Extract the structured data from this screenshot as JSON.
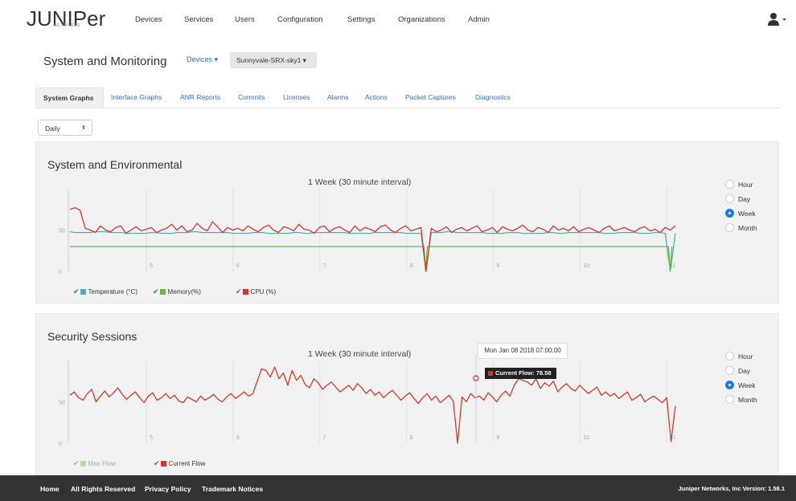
{
  "app": {
    "logo": "JUNIPer",
    "logo_sub": "NETWORKS"
  },
  "nav": {
    "items": [
      "Devices",
      "Services",
      "Users",
      "Configuration",
      "Settings",
      "Organizations",
      "Admin"
    ]
  },
  "header": {
    "title": "System and Monitoring",
    "devices_link": "Devices ▾",
    "device_select": "Sunnyvale-SRX-sky1 ▾"
  },
  "tabs": [
    "System Graphs",
    "Interface Graphs",
    "ANR Reports",
    "Commits",
    "Licenses",
    "Alarms",
    "Actions",
    "Packet Captures",
    "Diagnostics"
  ],
  "active_tab": "System Graphs",
  "period_select": {
    "value": "Daily",
    "arrow": "⬍"
  },
  "radio_options": [
    "Hour",
    "Day",
    "Week",
    "Month"
  ],
  "radio_selected": "Week",
  "colors": {
    "temperature": "#5aabaf",
    "memory": "#68b83c",
    "cpu": "#cc3a2e",
    "max_flow": "#b9dab0",
    "current_flow": "#cc3a2e",
    "accent": "#1e7be0"
  },
  "panels": {
    "system": {
      "title": "System and Environmental",
      "subtitle": "1 Week (30 minute interval)",
      "legend": [
        "Temperature (°C)",
        "Memory(%)",
        "CPU (%)"
      ]
    },
    "security": {
      "title": "Security Sessions",
      "subtitle": "1 Week (30 minute interval)",
      "legend": [
        "Max Flow",
        "Current Flow"
      ],
      "tooltip_date": "Mon Jan 08 2018 07:00:00",
      "tooltip_value": "Current Flow: 78.58"
    }
  },
  "chart_data": [
    {
      "type": "line",
      "title": "System and Environmental",
      "subtitle": "1 Week (30 minute interval)",
      "x_ticks": [
        "5",
        "6",
        "7",
        "8",
        "9",
        "10",
        "11"
      ],
      "y_ticks": [
        "0",
        "50"
      ],
      "x_range": [
        4.1,
        11.1
      ],
      "ylim": [
        0,
        100
      ],
      "grid": true,
      "legend": "bottom-left",
      "series": [
        {
          "name": "Temperature (°C)",
          "color": "#5aabaf",
          "base": 47,
          "noise": 1.2,
          "values": [
            48,
            47,
            47,
            47,
            47,
            48,
            48,
            48,
            47,
            47,
            47,
            46,
            46,
            46,
            46,
            46,
            47,
            47,
            46,
            46,
            46,
            47,
            47,
            47,
            48,
            48,
            47,
            47,
            47,
            47,
            47,
            47,
            46,
            46,
            46,
            46,
            47,
            47,
            47,
            46,
            46,
            46,
            46,
            46,
            47,
            47,
            46,
            46,
            47,
            47,
            47,
            47,
            47,
            47,
            47,
            46,
            46,
            46,
            46,
            46,
            47,
            47,
            47,
            47,
            47,
            47,
            46,
            46,
            46,
            46,
            46,
            47,
            47,
            47,
            48,
            48,
            47,
            47,
            47,
            47,
            47,
            47,
            46,
            46,
            46,
            46,
            47,
            47,
            47,
            46,
            46,
            46,
            46,
            46,
            47,
            47,
            46,
            46,
            47,
            47,
            47,
            47,
            47,
            47,
            47,
            46,
            46,
            46,
            47,
            47,
            47,
            47,
            46,
            46,
            46,
            47,
            47,
            46,
            46,
            46
          ]
        },
        {
          "name": "Memory(%)",
          "color": "#68b83c",
          "values": [
            30,
            30,
            30,
            30,
            30,
            30,
            30,
            30,
            30,
            30,
            30,
            30,
            30,
            30,
            30,
            30,
            30,
            30,
            30,
            30
          ]
        },
        {
          "name": "CPU (%)",
          "color": "#cc3a2e",
          "values": [
            75,
            77,
            74,
            52,
            50,
            47,
            55,
            50,
            48,
            53,
            55,
            46,
            50,
            54,
            49,
            51,
            53,
            47,
            50,
            52,
            57,
            50,
            55,
            48,
            50,
            58,
            52,
            49,
            60,
            54,
            47,
            53,
            50,
            52,
            49,
            55,
            51,
            48,
            53,
            56,
            50,
            47,
            54,
            52,
            49,
            57,
            51,
            50,
            46,
            53,
            55,
            48,
            52,
            54,
            50,
            47,
            55,
            49,
            53,
            51,
            48,
            54,
            56,
            50,
            47,
            52,
            55,
            49,
            51,
            53,
            0,
            52,
            48,
            50,
            54,
            47,
            51,
            53,
            49,
            52,
            55,
            48,
            50,
            53,
            47,
            54,
            51,
            49,
            52,
            56,
            50,
            48,
            53,
            51,
            47,
            55,
            50,
            52,
            49,
            54,
            48,
            51,
            53,
            50,
            47,
            52,
            55,
            49,
            51,
            53,
            50,
            48,
            52,
            54,
            49,
            51,
            47,
            53,
            50,
            55
          ]
        }
      ]
    },
    {
      "type": "line",
      "title": "Security Sessions",
      "subtitle": "1 Week (30 minute interval)",
      "x_ticks": [
        "5",
        "6",
        "7",
        "8",
        "9",
        "10",
        "11"
      ],
      "y_ticks": [
        "0",
        "50"
      ],
      "x_range": [
        4.1,
        11.1
      ],
      "ylim": [
        0,
        100
      ],
      "grid": true,
      "legend": "bottom-left",
      "series": [
        {
          "name": "Max Flow",
          "color": "#b9dab0",
          "values": []
        },
        {
          "name": "Current Flow",
          "color": "#cc3a2e",
          "values": [
            58,
            62,
            55,
            52,
            60,
            65,
            50,
            57,
            63,
            56,
            61,
            67,
            59,
            53,
            58,
            62,
            55,
            49,
            57,
            61,
            52,
            55,
            60,
            54,
            58,
            51,
            49,
            56,
            53,
            50,
            57,
            52,
            55,
            59,
            53,
            50,
            56,
            60,
            54,
            58,
            62,
            57,
            60,
            75,
            90,
            88,
            80,
            92,
            78,
            85,
            70,
            88,
            76,
            82,
            71,
            67,
            78,
            73,
            65,
            70,
            74,
            68,
            62,
            66,
            70,
            64,
            72,
            67,
            60,
            65,
            58,
            62,
            55,
            60,
            64,
            58,
            52,
            57,
            61,
            54,
            48,
            55,
            60,
            52,
            57,
            49,
            53,
            58,
            51,
            0,
            56,
            50,
            60,
            55,
            57,
            52,
            61,
            56,
            50,
            58,
            63,
            57,
            70,
            78,
            76,
            74,
            70,
            78,
            66,
            73,
            69,
            75,
            62,
            68,
            72,
            66,
            63,
            70,
            65,
            60,
            64,
            68,
            58,
            62,
            57,
            60,
            54,
            58,
            62,
            52,
            55,
            59,
            50,
            54,
            57,
            53,
            49,
            55,
            2,
            45
          ]
        }
      ],
      "tooltip": {
        "date": "Mon Jan 08 2018 07:00:00",
        "series": "Current Flow",
        "value": 78.58
      }
    }
  ],
  "footer": {
    "links": [
      "Home",
      "All Rights Reserved",
      "Privacy Policy",
      "Trademark Notices"
    ],
    "version": "Juniper Networks, Inc Version: 1.58.1"
  }
}
